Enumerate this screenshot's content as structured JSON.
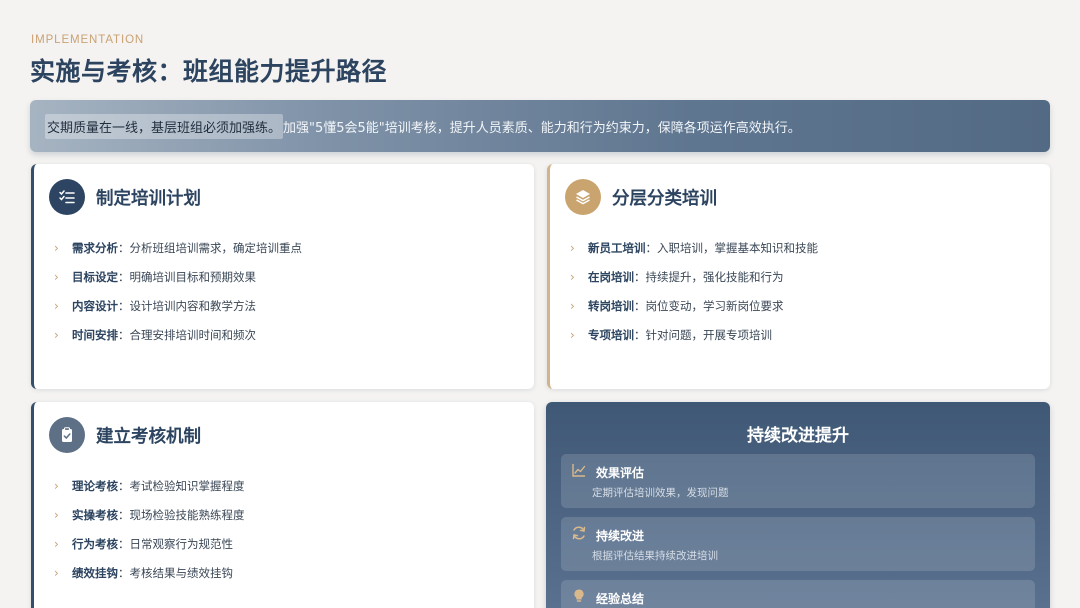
{
  "header": {
    "eyebrow": "IMPLEMENTATION",
    "title": "实施与考核：班组能力提升路径"
  },
  "banner": {
    "highlight": "交期质量在一线，基层班组必须加强练。",
    "rest": "加强\"5懂5会5能\"培训考核，提升人员素质、能力和行为约束力，保障各项运作高效执行。"
  },
  "cards": {
    "plan": {
      "title": "制定培训计划",
      "icon": "list-check-icon",
      "items": [
        {
          "key": "需求分析",
          "text": "：分析班组培训需求，确定培训重点"
        },
        {
          "key": "目标设定",
          "text": "：明确培训目标和预期效果"
        },
        {
          "key": "内容设计",
          "text": "：设计培训内容和教学方法"
        },
        {
          "key": "时间安排",
          "text": "：合理安排培训时间和频次"
        }
      ]
    },
    "layered": {
      "title": "分层分类培训",
      "icon": "layers-icon",
      "items": [
        {
          "key": "新员工培训",
          "text": "：入职培训，掌握基本知识和技能"
        },
        {
          "key": "在岗培训",
          "text": "：持续提升，强化技能和行为"
        },
        {
          "key": "转岗培训",
          "text": "：岗位变动，学习新岗位要求"
        },
        {
          "key": "专项培训",
          "text": "：针对问题，开展专项培训"
        }
      ]
    },
    "assess": {
      "title": "建立考核机制",
      "icon": "clipboard-check-icon",
      "items": [
        {
          "key": "理论考核",
          "text": "：考试检验知识掌握程度"
        },
        {
          "key": "实操考核",
          "text": "：现场检验技能熟练程度"
        },
        {
          "key": "行为考核",
          "text": "：日常观察行为规范性"
        },
        {
          "key": "绩效挂钩",
          "text": "：考核结果与绩效挂钩"
        }
      ]
    }
  },
  "improve": {
    "title": "持续改进提升",
    "items": [
      {
        "icon": "chart-line-icon",
        "title": "效果评估",
        "desc": "定期评估培训效果，发现问题"
      },
      {
        "icon": "refresh-icon",
        "title": "持续改进",
        "desc": "根据评估结果持续改进培训"
      },
      {
        "icon": "lightbulb-icon",
        "title": "经验总结",
        "desc": ""
      }
    ]
  },
  "colors": {
    "navy": "#2c4460",
    "gold": "#c9a273",
    "background": "#f4f3f1"
  }
}
